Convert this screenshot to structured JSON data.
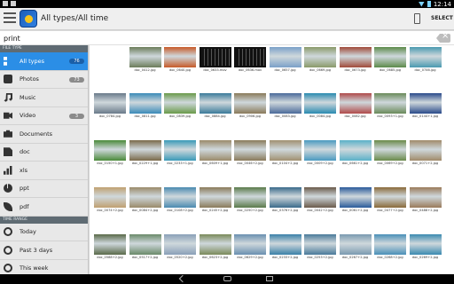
{
  "status_bar": {
    "time": "12:14"
  },
  "action_bar": {
    "title": "All types/All time",
    "select_label": "SELECT"
  },
  "search": {
    "value": "print"
  },
  "sidebar": {
    "file_type_header": "FILE TYPE",
    "time_range_header": "TIME RANGE",
    "file_types": [
      {
        "label": "All types",
        "count": "76",
        "icon": "grid-icon",
        "active": true
      },
      {
        "label": "Photos",
        "count": "73",
        "icon": "camera-icon",
        "active": false
      },
      {
        "label": "Music",
        "count": "",
        "icon": "music-note-icon",
        "active": false
      },
      {
        "label": "Video",
        "count": "3",
        "icon": "video-icon",
        "active": false
      },
      {
        "label": "Documents",
        "count": "",
        "icon": "briefcase-icon",
        "active": false
      },
      {
        "label": "doc",
        "count": "",
        "icon": "document-icon",
        "active": false
      },
      {
        "label": "xls",
        "count": "",
        "icon": "bar-chart-icon",
        "active": false
      },
      {
        "label": "ppt",
        "count": "",
        "icon": "pie-chart-icon",
        "active": false
      },
      {
        "label": "pdf",
        "count": "",
        "icon": "leaf-icon",
        "active": false
      }
    ],
    "time_ranges": [
      {
        "label": "Today",
        "icon": "clock-icon"
      },
      {
        "label": "Past 3 days",
        "icon": "clock-icon"
      },
      {
        "label": "This week",
        "icon": "clock-icon"
      }
    ]
  },
  "files": [
    {
      "name": "doc_0412.jpg",
      "c": "#6b7c5a"
    },
    {
      "name": "doc_0640.jpg",
      "c": "#c75a28"
    },
    {
      "name": "doc_0633.mov",
      "c": "#111111",
      "video": true
    },
    {
      "name": "doc_0636.mov",
      "c": "#111111",
      "video": true
    },
    {
      "name": "doc_0657.jpg",
      "c": "#7aa0c8"
    },
    {
      "name": "doc_0669.jpg",
      "c": "#8a9a6a"
    },
    {
      "name": "doc_0673.jpg",
      "c": "#a04a3a"
    },
    {
      "name": "doc_0685.jpg",
      "c": "#5c8a4a"
    },
    {
      "name": "doc_0746.jpg",
      "c": "#4a9ab0"
    },
    {
      "name": "doc_0784.jpg",
      "c": "#6a7a8a"
    },
    {
      "name": "doc_0811.jpg",
      "c": "#3a8ab8"
    },
    {
      "name": "doc_0839.jpg",
      "c": "#6a9a4a"
    },
    {
      "name": "doc_0884.jpg",
      "c": "#3a7a9a"
    },
    {
      "name": "doc_0906.jpg",
      "c": "#8a7a5a"
    },
    {
      "name": "doc_0083.jpg",
      "c": "#4a6a9a"
    },
    {
      "name": "doc_0084.jpg",
      "c": "#2a8ab0"
    },
    {
      "name": "doc_0082.jpg",
      "c": "#b04a4a"
    },
    {
      "name": "doc_0093+1.jpg",
      "c": "#6a8a5a"
    },
    {
      "name": "doc_0144+1.jpg",
      "c": "#2a4a8a"
    },
    {
      "name": "doc_0150+1.jpg",
      "c": "#4a8a3a"
    },
    {
      "name": "doc_0229+1.jpg",
      "c": "#7a6a4a"
    },
    {
      "name": "doc_0233+1.jpg",
      "c": "#3a9ab8"
    },
    {
      "name": "doc_0609+1.jpg",
      "c": "#9a8a6a"
    },
    {
      "name": "doc_0046+2.jpg",
      "c": "#8a7a5a"
    },
    {
      "name": "doc_0104+2.jpg",
      "c": "#a09070"
    },
    {
      "name": "doc_0009+2.jpg",
      "c": "#4a9ac0"
    },
    {
      "name": "doc_0661+2.jpg",
      "c": "#5ab0c8"
    },
    {
      "name": "doc_0069+2.jpg",
      "c": "#6a8a4a"
    },
    {
      "name": "doc_0071+2.jpg",
      "c": "#a08a6a"
    },
    {
      "name": "doc_0074+2.jpg",
      "c": "#c0a070"
    },
    {
      "name": "doc_0084+2.jpg",
      "c": "#9a8a6a"
    },
    {
      "name": "doc_0108+2.jpg",
      "c": "#4a8ab0"
    },
    {
      "name": "doc_0245+2.jpg",
      "c": "#8a7a5a"
    },
    {
      "name": "doc_0250+2.jpg",
      "c": "#5a7a4a"
    },
    {
      "name": "doc_0376+2.jpg",
      "c": "#3a6a8a"
    },
    {
      "name": "doc_0042+2.jpg",
      "c": "#6a5a4a"
    },
    {
      "name": "doc_0061+2.jpg",
      "c": "#2a5a9a"
    },
    {
      "name": "doc_0477+2.jpg",
      "c": "#8a6a3a"
    },
    {
      "name": "doc_0488+2.jpg",
      "c": "#9a7a5a"
    },
    {
      "name": "doc_0588+2.jpg",
      "c": "#5a6a4a"
    },
    {
      "name": "doc_0517+2.jpg",
      "c": "#6a8a6a"
    },
    {
      "name": "doc_0520+2.jpg",
      "c": "#8aa0b8"
    },
    {
      "name": "doc_0623+2.jpg",
      "c": "#7a8a5a"
    },
    {
      "name": "doc_0629+2.jpg",
      "c": "#6a90b0"
    },
    {
      "name": "doc_0233+2.jpg",
      "c": "#3a80a8"
    },
    {
      "name": "doc_0253+2.jpg",
      "c": "#4a7a9a"
    },
    {
      "name": "doc_0267+2.jpg",
      "c": "#7a9ab0"
    },
    {
      "name": "doc_0268+2.jpg",
      "c": "#4a90b8"
    },
    {
      "name": "doc_0269+2.jpg",
      "c": "#3a8ab0"
    },
    {
      "name": "doc_0263+2.jpg",
      "c": "#5ab0c8"
    }
  ],
  "row_sizes": [
    9,
    10,
    10,
    10,
    10
  ]
}
